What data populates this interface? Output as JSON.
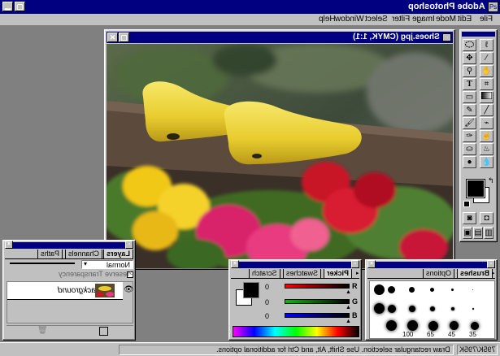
{
  "app": {
    "title": "Adobe Photoshop"
  },
  "menubar": {
    "items": [
      "File",
      "Edit",
      "Mode",
      "Image",
      "Filter",
      "Select",
      "Window",
      "Help"
    ]
  },
  "document": {
    "title": "Shoes.jpg (CMYK, 1:1)"
  },
  "layers_panel": {
    "tabs": [
      "Layers",
      "Channels",
      "Paths"
    ],
    "blend_mode": "Normal",
    "preserve_transparency": "Preserve Transparency",
    "layer_name": "Background"
  },
  "picker_panel": {
    "tabs": [
      "Picker",
      "Swatches",
      "Scratch"
    ],
    "channels": [
      {
        "label": "R",
        "value": "0",
        "color": "#ff0000"
      },
      {
        "label": "G",
        "value": "0",
        "color": "#00c000"
      },
      {
        "label": "B",
        "value": "0",
        "color": "#0000ff"
      }
    ]
  },
  "brushes_panel": {
    "tabs": [
      "Brushes",
      "Options"
    ],
    "size_labels": [
      "35",
      "45",
      "65",
      "100"
    ]
  },
  "status_bar": {
    "info": "Draw rectangular selection. Use Shift, Alt, and Ctrl for additional options.",
    "doc_size": "795K/795K"
  },
  "toolbox": {
    "tools": [
      "marquee-icon",
      "lasso-icon",
      "move-icon",
      "crop-icon",
      "magic-wand-icon",
      "hand-icon",
      "zoom-icon",
      "type-icon",
      "crop2-icon",
      "eraser-icon",
      "gradient-icon",
      "pencil-icon",
      "line-icon",
      "brush-icon",
      "eyedropper-icon",
      "airbrush-icon",
      "smudge-icon",
      "stamp-icon",
      "blur-icon",
      "dodge-icon",
      "burn-icon"
    ]
  },
  "colors": {
    "titlebar": "#000080",
    "face": "#c0c0c0",
    "workspace": "#808080"
  }
}
